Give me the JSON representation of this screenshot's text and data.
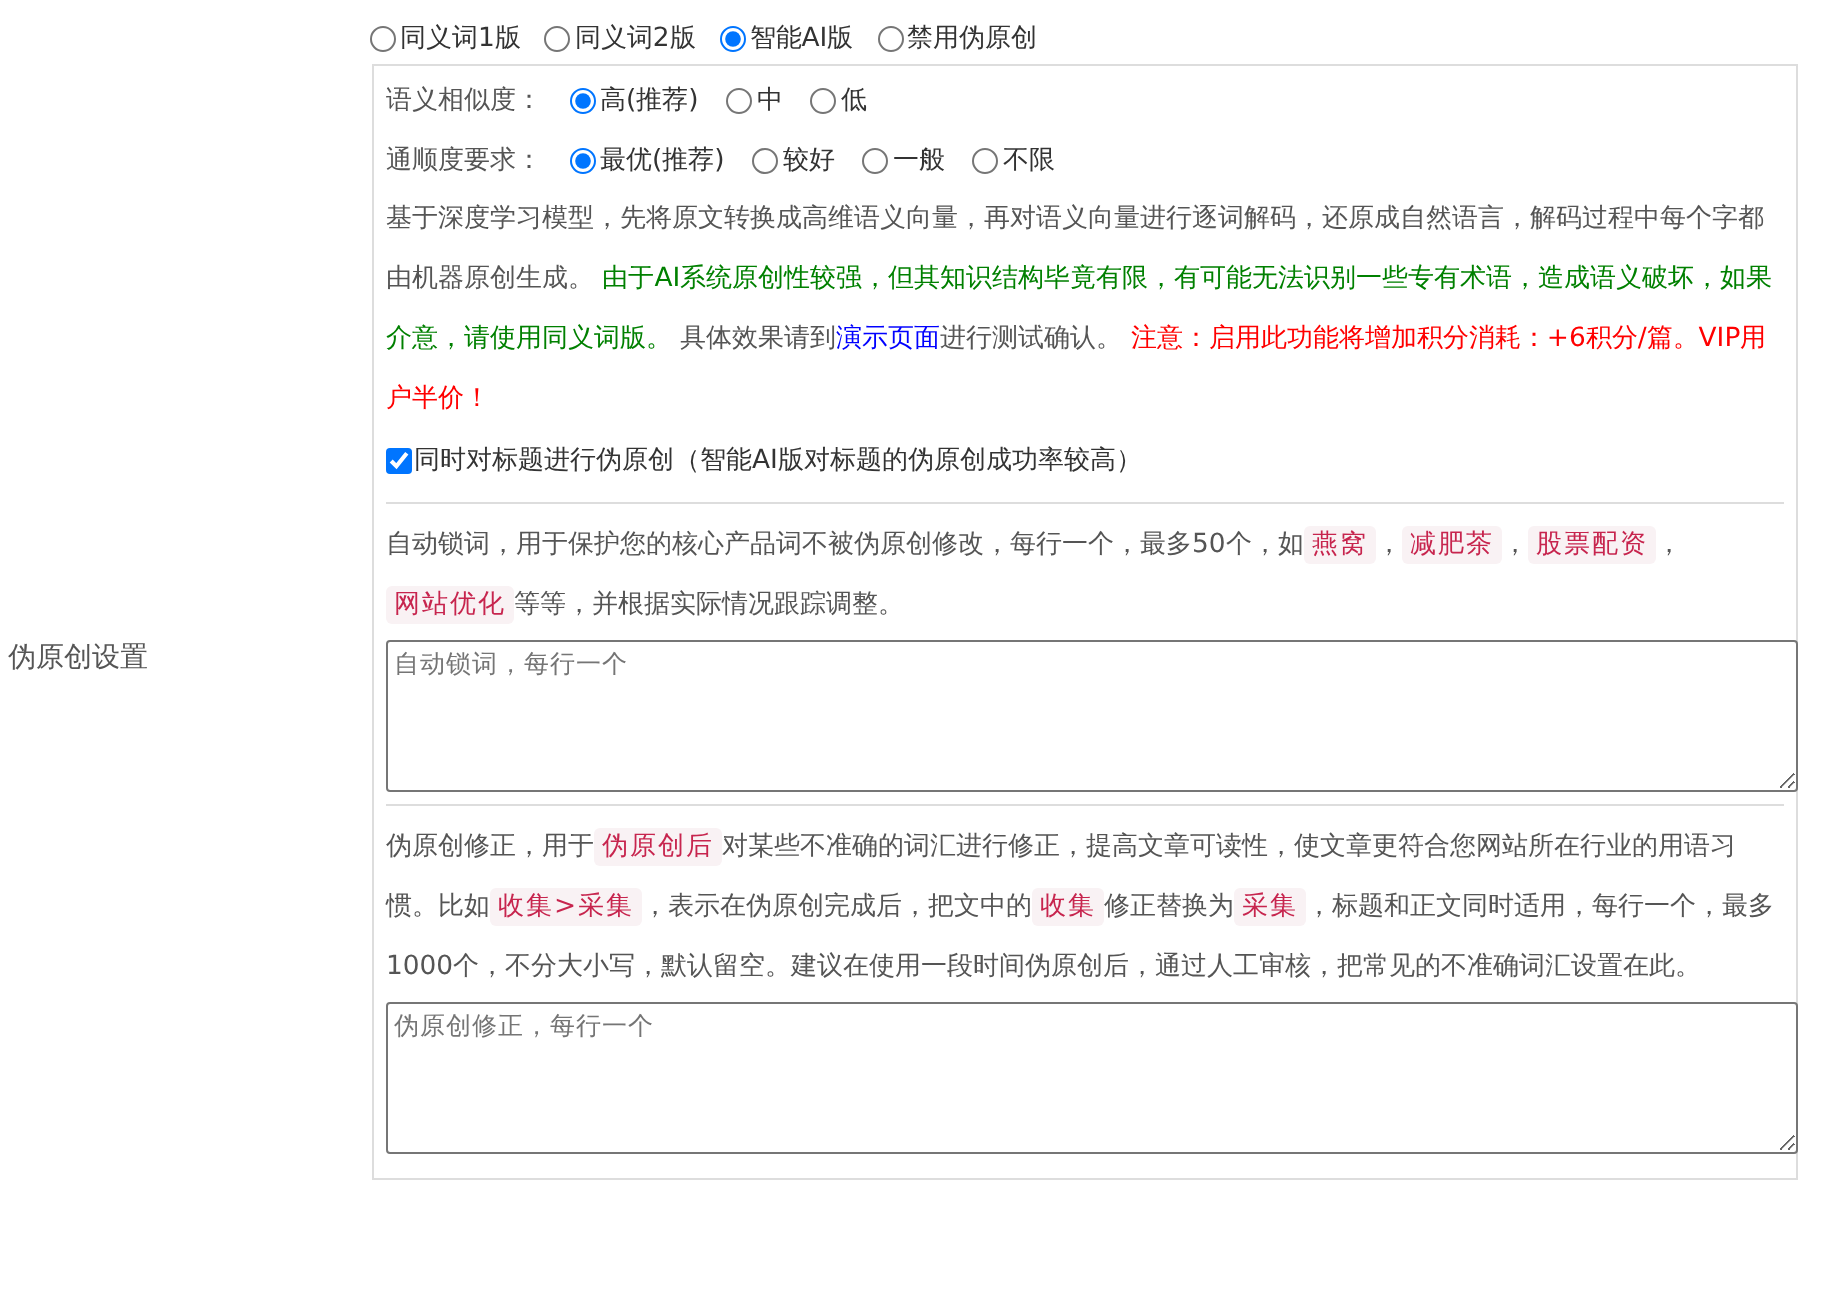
{
  "label": "伪原创设置",
  "modes": [
    {
      "label": "同义词1版",
      "selected": false
    },
    {
      "label": "同义词2版",
      "selected": false
    },
    {
      "label": "智能AI版",
      "selected": true
    },
    {
      "label": "禁用伪原创",
      "selected": false
    }
  ],
  "settings": [
    {
      "label": "语义相似度：",
      "options": [
        {
          "label": "高(推荐)",
          "selected": true
        },
        {
          "label": "中",
          "selected": false
        },
        {
          "label": "低",
          "selected": false
        }
      ]
    },
    {
      "label": "通顺度要求：",
      "options": [
        {
          "label": "最优(推荐)",
          "selected": true
        },
        {
          "label": "较好",
          "selected": false
        },
        {
          "label": "一般",
          "selected": false
        },
        {
          "label": "不限",
          "selected": false
        }
      ]
    }
  ],
  "description": [
    {
      "kind": "plain",
      "text": "基于深度学习模型，先将原文转换成高维语义向量，再对语义向量进行逐词解码，还原成自然语言，解码过程中每个字都由机器原创生成。 "
    },
    {
      "kind": "green",
      "text": "由于AI系统原创性较强，但其知识结构毕竟有限，有可能无法识别一些专有术语，造成语义破坏，如果介意，请使用同义词版。"
    },
    {
      "kind": "plain",
      "text": " 具体效果请到"
    },
    {
      "kind": "link",
      "text": "演示页面"
    },
    {
      "kind": "plain",
      "text": "进行测试确认。 "
    },
    {
      "kind": "red",
      "text": "注意：启用此功能将增加积分消耗：+6积分/篇。VIP用户半价！"
    }
  ],
  "title_option": {
    "label": "同时对标题进行伪原创（智能AI版对标题的伪原创成功率较高）",
    "checked": true
  },
  "sections": [
    {
      "description": [
        {
          "kind": "plain",
          "text": "自动锁词，用于保护您的核心产品词不被伪原创修改，每行一个，最多50个，如"
        },
        {
          "kind": "code",
          "text": "燕窝"
        },
        {
          "kind": "plain",
          "text": "，"
        },
        {
          "kind": "code",
          "text": "减肥茶"
        },
        {
          "kind": "plain",
          "text": "，"
        },
        {
          "kind": "code",
          "text": "股票配资"
        },
        {
          "kind": "plain",
          "text": "，"
        },
        {
          "kind": "code",
          "text": "网站优化"
        },
        {
          "kind": "plain",
          "text": "等等，并根据实际情况跟踪调整。"
        }
      ],
      "placeholder": "自动锁词，每行一个"
    },
    {
      "description": [
        {
          "kind": "plain",
          "text": "伪原创修正，用于"
        },
        {
          "kind": "code",
          "text": "伪原创后"
        },
        {
          "kind": "plain",
          "text": "对某些不准确的词汇进行修正，提高文章可读性，使文章更符合您网站所在行业的用语习惯。比如"
        },
        {
          "kind": "code",
          "text": "收集>采集"
        },
        {
          "kind": "plain",
          "text": "，表示在伪原创完成后，把文中的"
        },
        {
          "kind": "code",
          "text": "收集"
        },
        {
          "kind": "plain",
          "text": "修正替换为"
        },
        {
          "kind": "code",
          "text": "采集"
        },
        {
          "kind": "plain",
          "text": "，标题和正文同时适用，每行一个，最多1000个，不分大小写，默认留空。建议在使用一段时间伪原创后，通过人工审核，把常见的不准确词汇设置在此。"
        }
      ],
      "placeholder": "伪原创修正，每行一个"
    }
  ]
}
